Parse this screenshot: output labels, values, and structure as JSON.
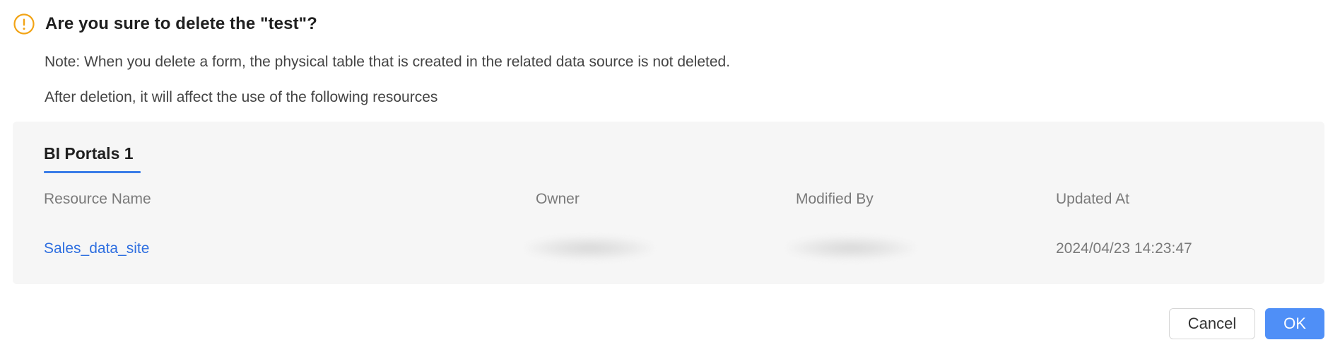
{
  "dialog": {
    "title": "Are you sure to delete the \"test\"?",
    "icon": "warning-circle-icon",
    "icon_color": "#f2a416",
    "note": "Note: When you delete a form, the physical table that is created in the related data source is not deleted.",
    "affect_text": "After deletion, it will affect the use of the following resources"
  },
  "resources": {
    "tab_label": "BI Portals 1",
    "columns": [
      "Resource Name",
      "Owner",
      "Modified By",
      "Updated At"
    ],
    "rows": [
      {
        "resource_name": "Sales_data_site",
        "owner": "",
        "modified_by": "",
        "updated_at": "2024/04/23 14:23:47"
      }
    ]
  },
  "footer": {
    "cancel_label": "Cancel",
    "ok_label": "OK"
  },
  "colors": {
    "accent": "#3b7de8",
    "link": "#2f6fe0",
    "ok_button": "#4f8ff7",
    "panel_bg": "#f6f6f6"
  }
}
